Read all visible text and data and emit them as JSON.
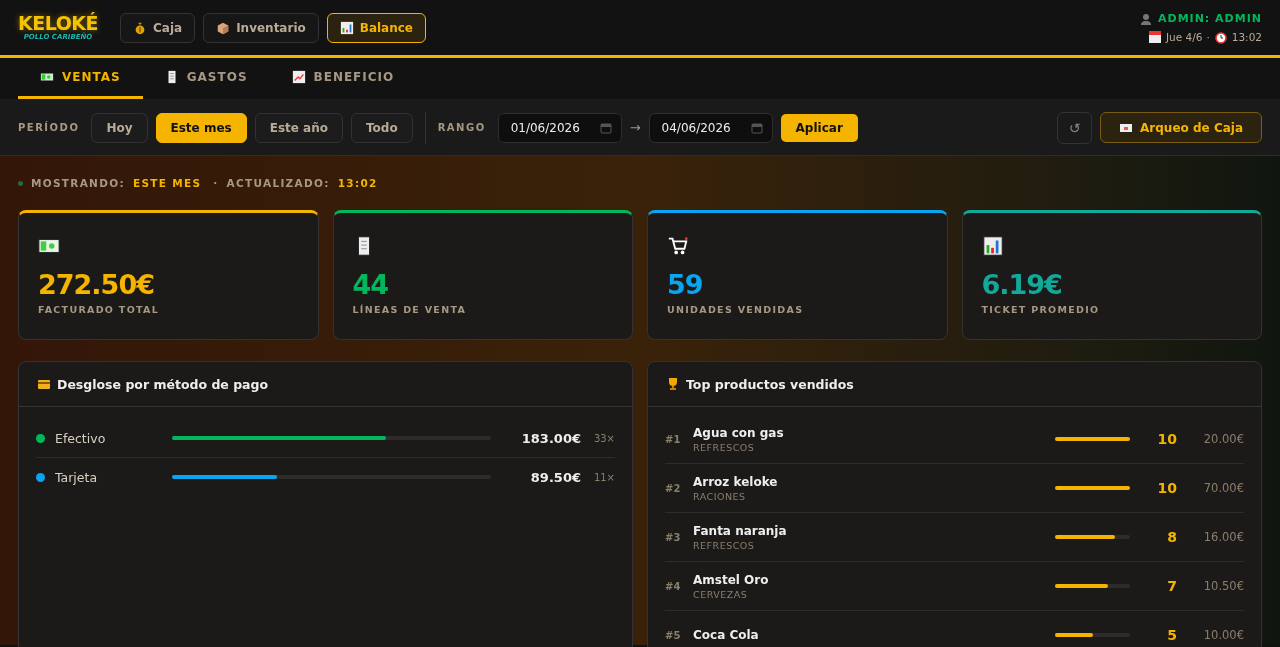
{
  "header": {
    "logo": {
      "title": "KELOKÉ",
      "subtitle": "POLLO CARIBEÑO"
    },
    "nav": [
      {
        "label": "Caja",
        "selected": false
      },
      {
        "label": "Inventario",
        "selected": false
      },
      {
        "label": "Balance",
        "selected": true
      }
    ],
    "user": "ADMIN: ADMIN",
    "date": "Jue 4/6",
    "separator": "·",
    "time": "13:02"
  },
  "subtabs": [
    {
      "label": "VENTAS",
      "selected": true
    },
    {
      "label": "GASTOS",
      "selected": false
    },
    {
      "label": "BENEFICIO",
      "selected": false
    }
  ],
  "filters": {
    "period_label": "PERÍODO",
    "periods": [
      {
        "label": "Hoy",
        "selected": false
      },
      {
        "label": "Este mes",
        "selected": true
      },
      {
        "label": "Este año",
        "selected": false
      },
      {
        "label": "Todo",
        "selected": false
      }
    ],
    "range_label": "RANGO",
    "date_from": "01/06/2026",
    "arrow": "→",
    "date_to": "04/06/2026",
    "apply": "Aplicar",
    "refresh": "↺",
    "cash_count": "Arqueo de Caja"
  },
  "status": {
    "showing_label": "MOSTRANDO:",
    "showing_value": "ESTE MES",
    "separator": "·",
    "updated_label": "ACTUALIZADO:",
    "updated_value": "13:02"
  },
  "kpis": [
    {
      "value": "272.50€",
      "label": "FACTURADO TOTAL",
      "color": "#f5b400"
    },
    {
      "value": "44",
      "label": "LÍNEAS DE VENTA",
      "color": "#00b85c"
    },
    {
      "value": "59",
      "label": "UNIDADES VENDIDAS",
      "color": "#0aa5f0"
    },
    {
      "value": "6.19€",
      "label": "TICKET PROMEDIO",
      "color": "#12a89a"
    }
  ],
  "payment_breakdown": {
    "title": "Desglose por método de pago",
    "methods": [
      {
        "name": "Efectivo",
        "color": "#00b85c",
        "level": 0.67,
        "amount": "183.00€",
        "count": "33×"
      },
      {
        "name": "Tarjeta",
        "color": "#0aa5f0",
        "level": 0.33,
        "amount": "89.50€",
        "count": "11×"
      }
    ]
  },
  "top_products": {
    "title": "Top productos vendidos",
    "items": [
      {
        "rank": "#1",
        "name": "Agua con gas",
        "category": "REFRESCOS",
        "level": 1,
        "quantity": "10",
        "amount": "20.00€"
      },
      {
        "rank": "#2",
        "name": "Arroz keloke",
        "category": "RACIONES",
        "level": 1,
        "quantity": "10",
        "amount": "70.00€"
      },
      {
        "rank": "#3",
        "name": "Fanta naranja",
        "category": "REFRESCOS",
        "level": 0.8,
        "quantity": "8",
        "amount": "16.00€"
      },
      {
        "rank": "#4",
        "name": "Amstel Oro",
        "category": "CERVEZAS",
        "level": 0.7,
        "quantity": "7",
        "amount": "10.50€"
      },
      {
        "rank": "#5",
        "name": "Coca Cola",
        "level": 0.5,
        "quantity": "5",
        "amount": "10.00€"
      }
    ]
  }
}
